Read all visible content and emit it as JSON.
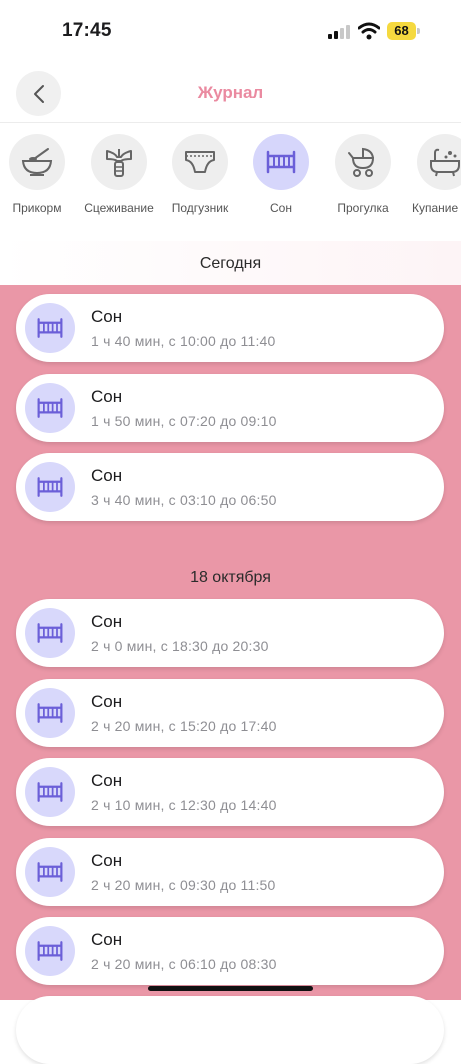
{
  "status_bar": {
    "time": "17:45",
    "battery": "68"
  },
  "header": {
    "title": "Журнал"
  },
  "categories": [
    {
      "label": "Прикорм",
      "icon": "bowl-icon"
    },
    {
      "label": "Сцеживание",
      "icon": "breast-pump-icon"
    },
    {
      "label": "Подгузник",
      "icon": "diaper-icon"
    },
    {
      "label": "Сон",
      "icon": "crib-icon",
      "active": true
    },
    {
      "label": "Прогулка",
      "icon": "stroller-icon"
    },
    {
      "label": "Купание",
      "icon": "bathtub-icon"
    }
  ],
  "sections": [
    {
      "title": "Сегодня",
      "entries": [
        {
          "title": "Сон",
          "detail": "1 ч 40 мин, с 10:00 до 11:40"
        },
        {
          "title": "Сон",
          "detail": "1 ч 50 мин, с 07:20 до 09:10"
        },
        {
          "title": "Сон",
          "detail": "3 ч 40 мин, с 03:10 до 06:50"
        }
      ]
    },
    {
      "title": "18 октября",
      "entries": [
        {
          "title": "Сон",
          "detail": "2 ч 0 мин, с 18:30 до 20:30"
        },
        {
          "title": "Сон",
          "detail": "2 ч 20 мин, с 15:20 до 17:40"
        },
        {
          "title": "Сон",
          "detail": "2 ч 10 мин, с 12:30 до 14:40"
        },
        {
          "title": "Сон",
          "detail": "2 ч 20 мин, с 09:30 до 11:50"
        },
        {
          "title": "Сон",
          "detail": "2 ч 20 мин, с 06:10 до 08:30"
        }
      ]
    }
  ],
  "colors": {
    "accent": "#ea8aa0",
    "list_background": "#ea97a7",
    "active_icon": "#6b5fd8",
    "active_circle": "#d6d6fb"
  }
}
